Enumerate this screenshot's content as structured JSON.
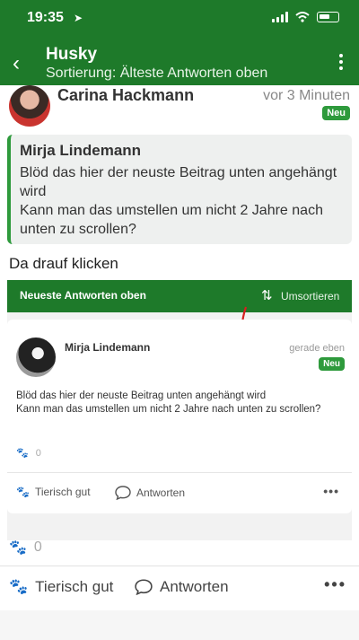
{
  "status_bar": {
    "time": "19:35"
  },
  "header": {
    "title": "Husky",
    "subtitle": "Sortierung: Älteste Antworten oben"
  },
  "post": {
    "author": "Carina Hackmann",
    "time_ago": "vor 3 Minuten",
    "badge": "Neu",
    "quote": {
      "author": "Mirja Lindemann",
      "text": "Blöd das hier der neuste Beitrag unten angehängt wird\nKann man das umstellen um nicht 2 Jahre nach unten zu scrollen?"
    },
    "comment": "Da drauf klicken",
    "reaction_count": "0",
    "actions": {
      "like": "Tierisch gut",
      "reply": "Antworten"
    }
  },
  "embedded_screenshot": {
    "bar_title": "Neueste Antworten oben",
    "sort_label": "Umsortieren",
    "author": "Mirja Lindemann",
    "time": "gerade eben",
    "badge": "Neu",
    "text": "Blöd das hier der neuste Beitrag unten angehängt wird\nKann man das umstellen um nicht 2 Jahre nach unten zu scrollen?",
    "reaction_count": "0",
    "actions": {
      "like": "Tierisch gut",
      "reply": "Antworten"
    }
  },
  "colors": {
    "brand_green": "#1e7a2a",
    "badge_green": "#2e9a3c",
    "annotation_red": "#d62020"
  }
}
